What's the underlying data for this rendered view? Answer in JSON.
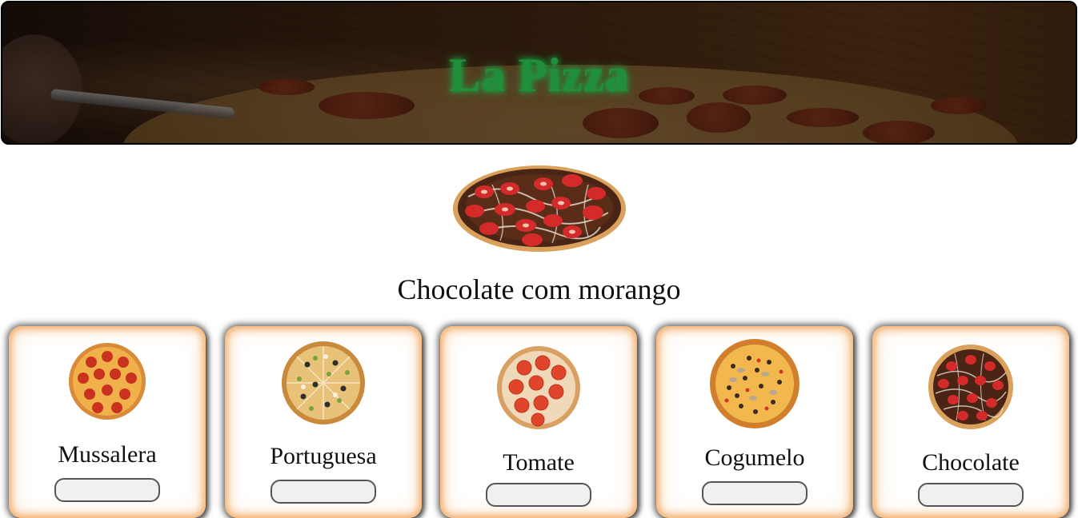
{
  "header": {
    "title": "La Pizza"
  },
  "featured": {
    "image_icon": "chocolate-strawberry-pizza-image",
    "title": "Chocolate com morango"
  },
  "cards": [
    {
      "name": "Mussalera",
      "image_icon": "pepperoni-pizza-image"
    },
    {
      "name": "Portuguesa",
      "image_icon": "portuguesa-pizza-image"
    },
    {
      "name": "Tomate",
      "image_icon": "tomato-pizza-image"
    },
    {
      "name": "Cogumelo",
      "image_icon": "mushroom-pizza-image"
    },
    {
      "name": "Chocolate",
      "image_icon": "chocolate-pizza-image"
    }
  ],
  "colors": {
    "title_green": "#1f8f3a",
    "card_glow": "#f2a863"
  }
}
